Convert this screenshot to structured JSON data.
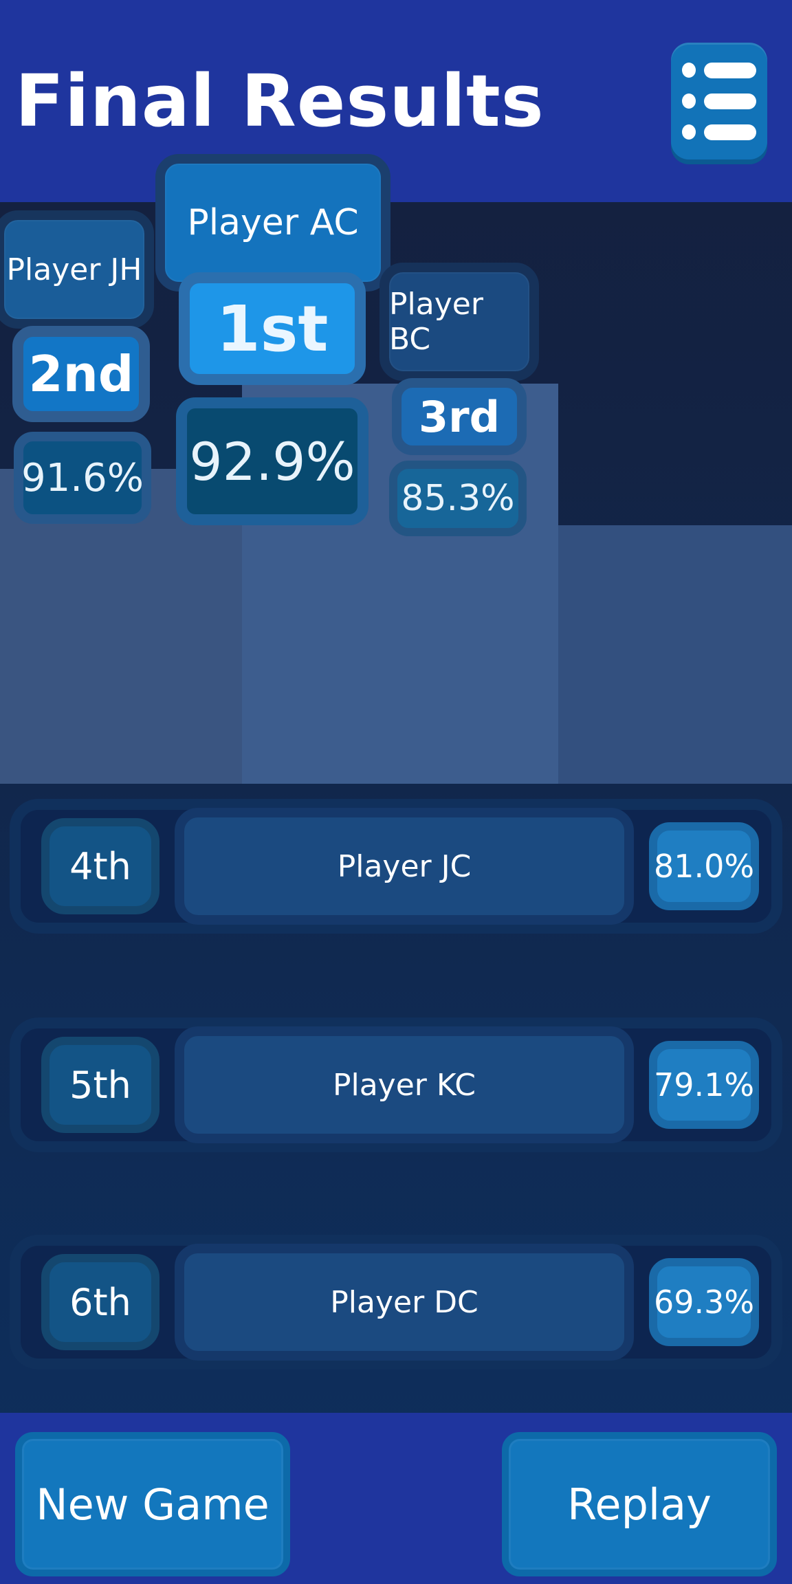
{
  "header": {
    "title": "Final Results",
    "menu_icon": "list-icon"
  },
  "podium": [
    {
      "place": "1st",
      "player": "Player AC",
      "percent": "92.9%"
    },
    {
      "place": "2nd",
      "player": "Player JH",
      "percent": "91.6%"
    },
    {
      "place": "3rd",
      "player": "Player BC",
      "percent": "85.3%"
    }
  ],
  "rows": [
    {
      "rank": "4th",
      "player": "Player JC",
      "percent": "81.0%"
    },
    {
      "rank": "5th",
      "player": "Player KC",
      "percent": "79.1%"
    },
    {
      "rank": "6th",
      "player": "Player DC",
      "percent": "69.3%"
    }
  ],
  "footer": {
    "new_game_label": "New Game",
    "replay_label": "Replay"
  },
  "colors": {
    "header_bg": "#1f359e",
    "page_bg_top": "#141f3d",
    "page_bg_bottom": "#0d2f5e",
    "accent_blue": "#1e96e8",
    "button_blue": "#1377bd"
  }
}
